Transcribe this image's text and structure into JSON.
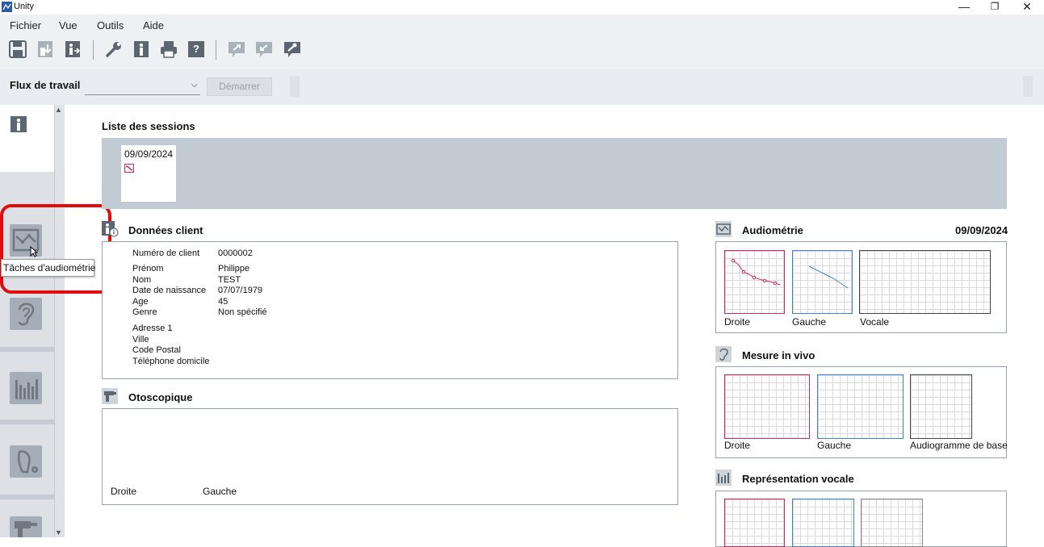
{
  "window": {
    "title": "Unity",
    "controls": {
      "minimize": "—",
      "restore": "❐",
      "close": "✕"
    }
  },
  "menu": [
    "Fichier",
    "Vue",
    "Outils",
    "Aide"
  ],
  "toolbar": {
    "icons": [
      "save-icon",
      "import-icon",
      "client-transfer-icon",
      "wrench-icon",
      "client-icon",
      "print-icon",
      "help-icon",
      "export-icon",
      "receive-icon",
      "tools-icon"
    ]
  },
  "workflow": {
    "label": "Flux de travail",
    "select_value": "",
    "start_label": "Démarrer"
  },
  "sidebar": {
    "tooltip": "Tâches d'audiométrie"
  },
  "sessions": {
    "title": "Liste des sessions",
    "items": [
      {
        "date": "09/09/2024"
      }
    ]
  },
  "client": {
    "title": "Données client",
    "rows1": [
      {
        "label": "Numéro de client",
        "value": "0000002"
      }
    ],
    "rows2": [
      {
        "label": "Prénom",
        "value": "Philippe"
      },
      {
        "label": "Nom",
        "value": "TEST"
      },
      {
        "label": "Date de naissance",
        "value": "07/07/1979"
      },
      {
        "label": "Age",
        "value": "45"
      },
      {
        "label": "Genre",
        "value": "Non spécifié"
      }
    ],
    "rows3": [
      {
        "label": "Adresse 1",
        "value": ""
      },
      {
        "label": "Ville",
        "value": ""
      },
      {
        "label": "Code Postal",
        "value": ""
      },
      {
        "label": "Téléphone domicile",
        "value": ""
      }
    ]
  },
  "otoscopy": {
    "title": "Otoscopique",
    "right": "Droite",
    "left": "Gauche"
  },
  "audiometry": {
    "title": "Audiométrie",
    "date": "09/09/2024",
    "labels": [
      "Droite",
      "Gauche",
      "Vocale"
    ],
    "right_curve": [
      12,
      17,
      26,
      29,
      33,
      35,
      37,
      38,
      40,
      42
    ],
    "left_curve": [
      19,
      22,
      25,
      28,
      31,
      34,
      38,
      42,
      46
    ]
  },
  "invivo": {
    "title": "Mesure in vivo",
    "labels": [
      "Droite",
      "Gauche",
      "Audiogramme de base"
    ]
  },
  "speech": {
    "title": "Représentation vocale"
  },
  "colors": {
    "right": "#d0285a",
    "left": "#3f7fe0",
    "highlight": "#e00c0c"
  }
}
